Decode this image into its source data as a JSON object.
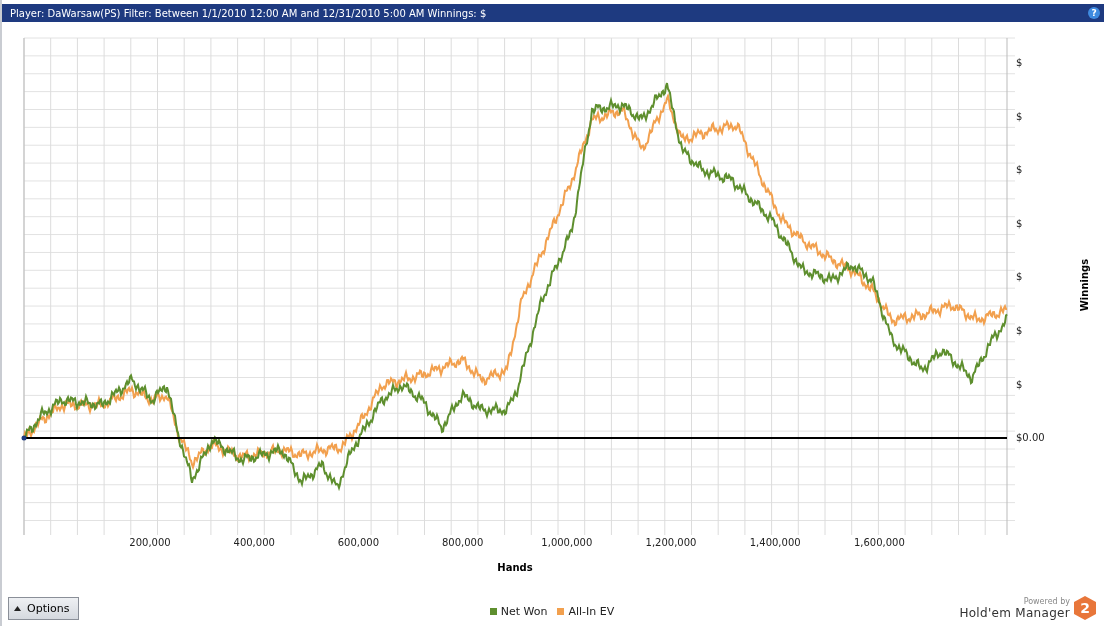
{
  "header": {
    "text": "Player: DaWarsaw(PS) Filter: Between 1/1/2010 12:00 AM and 12/31/2010 5:00 AM  Winnings: $",
    "help": "?"
  },
  "chart": {
    "y_ticks": [
      "$",
      "$",
      "$",
      "$",
      "$",
      "$",
      "$",
      "$0.00"
    ],
    "x_ticks": [
      "200,000",
      "400,000",
      "600,000",
      "800,000",
      "1,000,000",
      "1,200,000",
      "1,400,000",
      "1,600,000"
    ],
    "xlabel": "Hands",
    "ylabel": "Winnings",
    "series": [
      {
        "name": "Net Won",
        "color": "#5e8f2e"
      },
      {
        "name": "All-In EV",
        "color": "#f2a04e"
      }
    ]
  },
  "options_button": {
    "label": "Options"
  },
  "branding": {
    "powered_by": "Powered by",
    "product": "Hold'em Manager",
    "badge": "2"
  }
}
